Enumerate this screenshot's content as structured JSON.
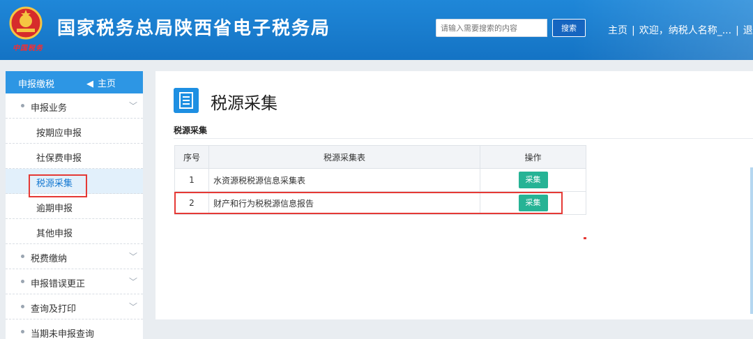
{
  "header": {
    "title": "国家税务总局陕西省电子税务局",
    "emblem_script": "中国税务",
    "search_placeholder": "请输入需要搜索的内容",
    "search_button": "搜索",
    "links": [
      "主页",
      "欢迎，纳税人名称_...",
      "退"
    ]
  },
  "sidebar": {
    "header_title": "申报缴税",
    "home_label": "主页",
    "items": [
      {
        "type": "group",
        "label": "申报业务"
      },
      {
        "type": "sub",
        "label": "按期应申报"
      },
      {
        "type": "sub",
        "label": "社保费申报"
      },
      {
        "type": "sub",
        "label": "税源采集",
        "active": true
      },
      {
        "type": "sub",
        "label": "逾期申报"
      },
      {
        "type": "sub",
        "label": "其他申报"
      },
      {
        "type": "group",
        "label": "税费缴纳"
      },
      {
        "type": "group",
        "label": "申报错误更正"
      },
      {
        "type": "group",
        "label": "查询及打印"
      },
      {
        "type": "group",
        "label": "当期未申报查询"
      }
    ]
  },
  "main": {
    "page_title": "税源采集",
    "section_title": "税源采集",
    "table": {
      "headers": [
        "序号",
        "税源采集表",
        "操作"
      ],
      "rows": [
        {
          "index": "1",
          "name": "水资源税税源信息采集表",
          "action": "采集"
        },
        {
          "index": "2",
          "name": "财产和行为税税源信息报告",
          "action": "采集"
        }
      ]
    }
  },
  "colors": {
    "header_blue": "#1a7dd0",
    "accent_green": "#26b395",
    "highlight_red": "#e53935"
  }
}
